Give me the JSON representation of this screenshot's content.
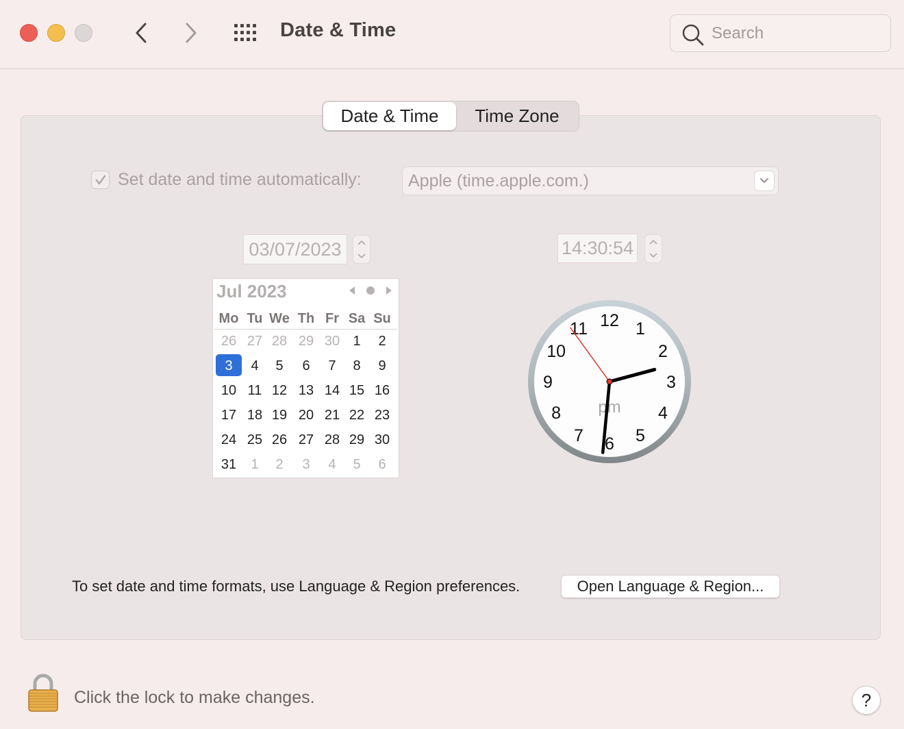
{
  "window": {
    "title": "Date & Time",
    "search": {
      "placeholder": "Search",
      "value": ""
    }
  },
  "tabs": [
    {
      "label": "Date & Time",
      "active": true
    },
    {
      "label": "Time Zone",
      "active": false
    }
  ],
  "auto_time": {
    "checked": true,
    "label": "Set date and time automatically:",
    "server": "Apple (time.apple.com.)"
  },
  "date_field": "03/07/2023",
  "time_field": "14:30:54",
  "calendar": {
    "month_label": "Jul 2023",
    "weekdays": [
      "Mo",
      "Tu",
      "We",
      "Th",
      "Fr",
      "Sa",
      "Su"
    ],
    "weeks": [
      [
        {
          "d": "26",
          "m": true
        },
        {
          "d": "27",
          "m": true
        },
        {
          "d": "28",
          "m": true
        },
        {
          "d": "29",
          "m": true
        },
        {
          "d": "30",
          "m": true
        },
        {
          "d": "1"
        },
        {
          "d": "2"
        }
      ],
      [
        {
          "d": "3",
          "sel": true
        },
        {
          "d": "4"
        },
        {
          "d": "5"
        },
        {
          "d": "6"
        },
        {
          "d": "7"
        },
        {
          "d": "8"
        },
        {
          "d": "9"
        }
      ],
      [
        {
          "d": "10"
        },
        {
          "d": "11"
        },
        {
          "d": "12"
        },
        {
          "d": "13"
        },
        {
          "d": "14"
        },
        {
          "d": "15"
        },
        {
          "d": "16"
        }
      ],
      [
        {
          "d": "17"
        },
        {
          "d": "18"
        },
        {
          "d": "19"
        },
        {
          "d": "20"
        },
        {
          "d": "21"
        },
        {
          "d": "22"
        },
        {
          "d": "23"
        }
      ],
      [
        {
          "d": "24"
        },
        {
          "d": "25"
        },
        {
          "d": "26"
        },
        {
          "d": "27"
        },
        {
          "d": "28"
        },
        {
          "d": "29"
        },
        {
          "d": "30"
        }
      ],
      [
        {
          "d": "31"
        },
        {
          "d": "1",
          "m": true
        },
        {
          "d": "2",
          "m": true
        },
        {
          "d": "3",
          "m": true
        },
        {
          "d": "4",
          "m": true
        },
        {
          "d": "5",
          "m": true
        },
        {
          "d": "6",
          "m": true
        }
      ]
    ],
    "selected_color": "#2f6fd8"
  },
  "clock": {
    "numbers": [
      "12",
      "1",
      "2",
      "3",
      "4",
      "5",
      "6",
      "7",
      "8",
      "9",
      "10",
      "11"
    ],
    "period": "pm",
    "hour": 14,
    "minute": 30,
    "second": 54,
    "second_hand_color": "#e0392c"
  },
  "format_text": "To set date and time formats, use Language & Region preferences.",
  "open_region_button": "Open Language & Region...",
  "lock_text": "Click the lock to make changes.",
  "help_label": "?",
  "colors": {
    "close": "#ec5f57",
    "minimize": "#f4bf4f",
    "zoom_disabled": "#dcd6d6"
  }
}
